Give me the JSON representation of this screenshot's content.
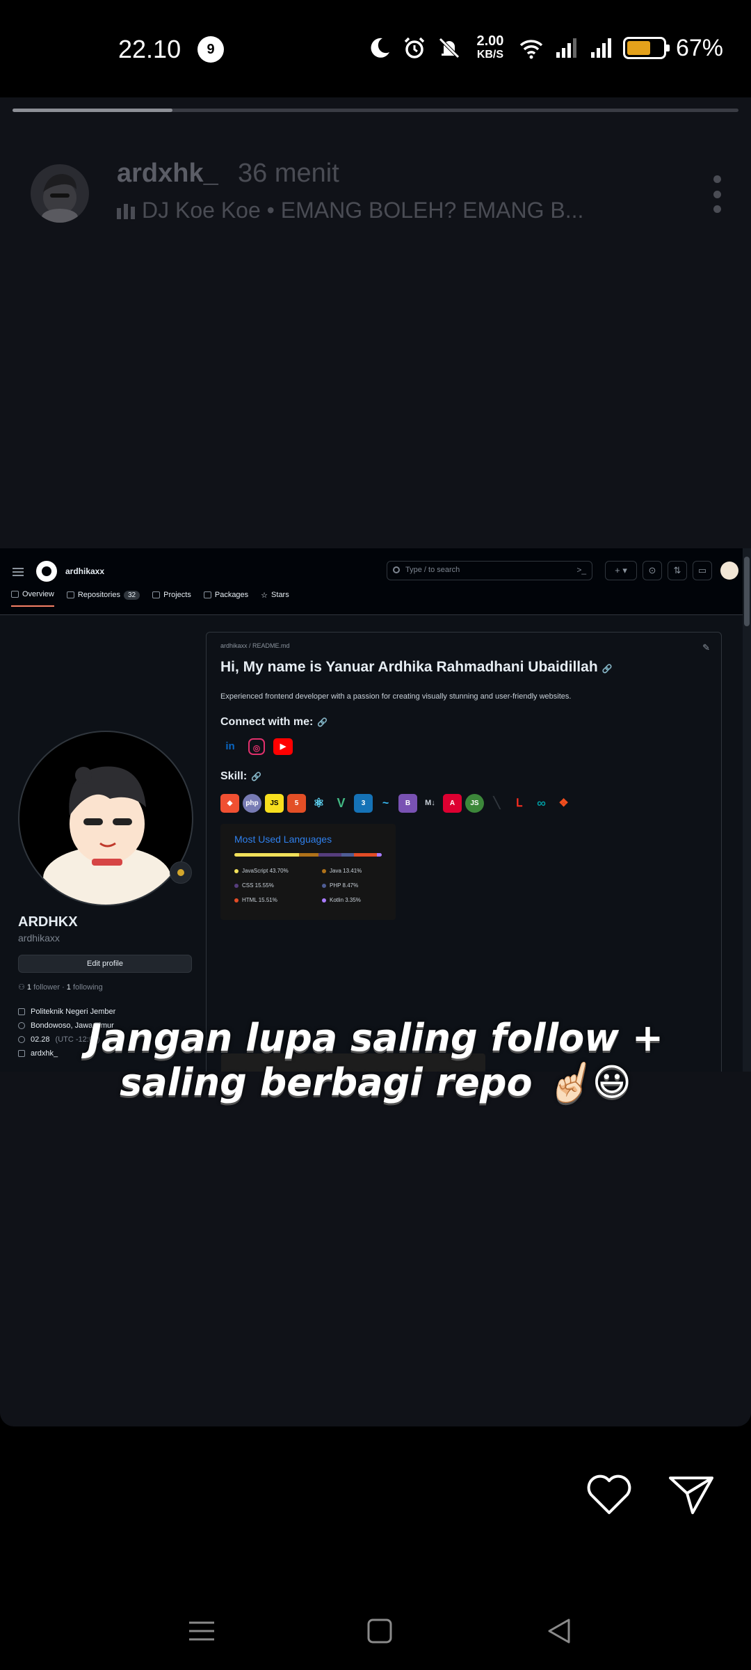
{
  "status_bar": {
    "time": "22.10",
    "notification_count": "9",
    "net_speed_value": "2.00",
    "net_speed_unit": "KB/S",
    "battery_percent": "67%",
    "battery_level": 0.67,
    "battery_color": "#e4a11b"
  },
  "story": {
    "progress": 0.22,
    "username": "ardxhk_",
    "posted_ago": "36 menit",
    "music": "DJ Koe Koe • EMANG BOLEH? EMANG B..."
  },
  "github": {
    "username": "ardhikaxx",
    "search_placeholder": "Type / to search",
    "tabs": [
      {
        "label": "Overview",
        "active": true
      },
      {
        "label": "Repositories",
        "count": "32"
      },
      {
        "label": "Projects"
      },
      {
        "label": "Packages"
      },
      {
        "label": "Stars"
      }
    ],
    "profile": {
      "display_name": "ARDHKX",
      "login": "ardhikaxx",
      "edit_button": "Edit profile",
      "followers_count": "1",
      "followers_label": "follower",
      "following_count": "1",
      "following_label": "following",
      "organization": "Politeknik Negeri Jember",
      "location": "Bondowoso, Jawa Timur",
      "local_time": "02.28",
      "timezone": "(UTC -12:00)",
      "social": "ardxhk_"
    },
    "readme": {
      "path": "ardhikaxx / README.md",
      "title": "Hi, My name is Yanuar Ardhika Rahmadhani Ubaidillah",
      "description": "Experienced frontend developer with a passion for creating visually stunning and user-friendly websites.",
      "connect_heading": "Connect with me:",
      "skill_heading": "Skill:",
      "social_icons": [
        "linkedin-icon",
        "instagram-icon",
        "youtube-icon"
      ],
      "skill_icons": [
        "git",
        "php",
        "js",
        "html5",
        "react",
        "vue",
        "css3",
        "tailwind",
        "bootstrap",
        "markdown",
        "angular",
        "nodejs",
        "laravel-alt",
        "laravel",
        "arduino",
        "figma"
      ],
      "languages_card": {
        "title": "Most Used Languages",
        "languages": [
          {
            "name": "JavaScript",
            "percent": "43.70%",
            "value": 43.7,
            "color": "#f1e05a"
          },
          {
            "name": "Java",
            "percent": "13.41%",
            "value": 13.41,
            "color": "#b07219"
          },
          {
            "name": "CSS",
            "percent": "15.55%",
            "value": 15.55,
            "color": "#563d7c"
          },
          {
            "name": "PHP",
            "percent": "8.47%",
            "value": 8.47,
            "color": "#4f5d95"
          },
          {
            "name": "HTML",
            "percent": "15.51%",
            "value": 15.51,
            "color": "#e34c26"
          },
          {
            "name": "Kotlin",
            "percent": "3.35%",
            "value": 3.35,
            "color": "#a97bff"
          }
        ]
      }
    }
  },
  "caption": {
    "line1": "Jangan lupa saling follow +",
    "line2": "saling berbagi repo ☝🏻😃"
  },
  "actions": {
    "like_icon": "heart-icon",
    "share_icon": "send-icon"
  },
  "nav": [
    "menu-icon",
    "home-icon",
    "back-icon"
  ]
}
